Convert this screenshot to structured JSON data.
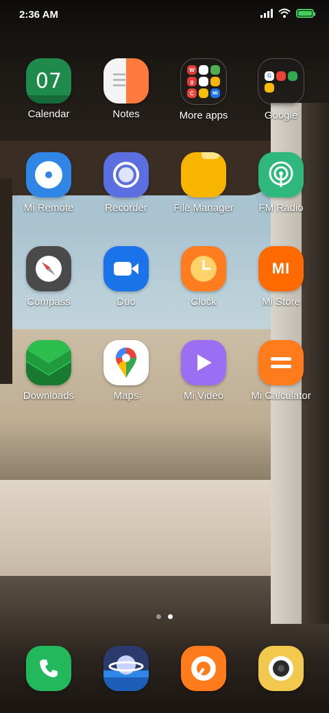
{
  "status_bar": {
    "time": "2:36 AM",
    "icons": [
      "signal-icon",
      "wifi-icon",
      "battery-charging-icon"
    ],
    "battery_level": 1.0,
    "battery_color": "#3fd15a"
  },
  "home_screen": {
    "apps": [
      {
        "label": "Calendar",
        "icon": "calendar-icon",
        "text": "07",
        "color": "#1e8a4c"
      },
      {
        "label": "Notes",
        "icon": "notes-icon",
        "color": "#ff7a3d"
      },
      {
        "label": "More apps",
        "icon": "folder-icon",
        "type": "folder"
      },
      {
        "label": "Google",
        "icon": "folder-icon",
        "type": "folder"
      },
      {
        "label": "Mi Remote",
        "icon": "remote-icon",
        "color": "#2f86e6"
      },
      {
        "label": "Recorder",
        "icon": "recorder-icon",
        "color": "#5b6fe0"
      },
      {
        "label": "File Manager",
        "icon": "folder-file-icon",
        "color": "#f7b500"
      },
      {
        "label": "FM Radio",
        "icon": "radio-icon",
        "color": "#2fb87d"
      },
      {
        "label": "Compass",
        "icon": "compass-icon",
        "color": "#4a4a4a"
      },
      {
        "label": "Duo",
        "icon": "video-camera-icon",
        "color": "#1a73e8"
      },
      {
        "label": "Clock",
        "icon": "clock-icon",
        "color": "#ff7d1f"
      },
      {
        "label": "Mi Store",
        "icon": "mi-store-icon",
        "text": "MI",
        "color": "#ff6a00"
      },
      {
        "label": "Downloads",
        "icon": "download-icon",
        "color": "#2ebd4f"
      },
      {
        "label": "Maps",
        "icon": "maps-pin-icon",
        "color": "#ffffff"
      },
      {
        "label": "Mi Video",
        "icon": "play-icon",
        "color": "#9b6ef3"
      },
      {
        "label": "Mi Calculator",
        "icon": "calculator-icon",
        "color": "#ff7b1c"
      }
    ],
    "folder_more_apps_letters": [
      "W",
      "",
      "",
      "g",
      "",
      "",
      "C",
      "",
      "Mi"
    ],
    "folder_google_letters": [
      "G",
      "",
      "",
      "",
      "",
      ""
    ]
  },
  "page_indicator": {
    "total": 2,
    "current": 2
  },
  "dock": [
    {
      "icon": "phone-icon",
      "color": "#22b95c"
    },
    {
      "icon": "browser-planet-icon",
      "color": "#2b3a6d"
    },
    {
      "icon": "music-icon",
      "color": "#ff7b1c"
    },
    {
      "icon": "camera-icon",
      "color": "#f2c94c"
    }
  ]
}
